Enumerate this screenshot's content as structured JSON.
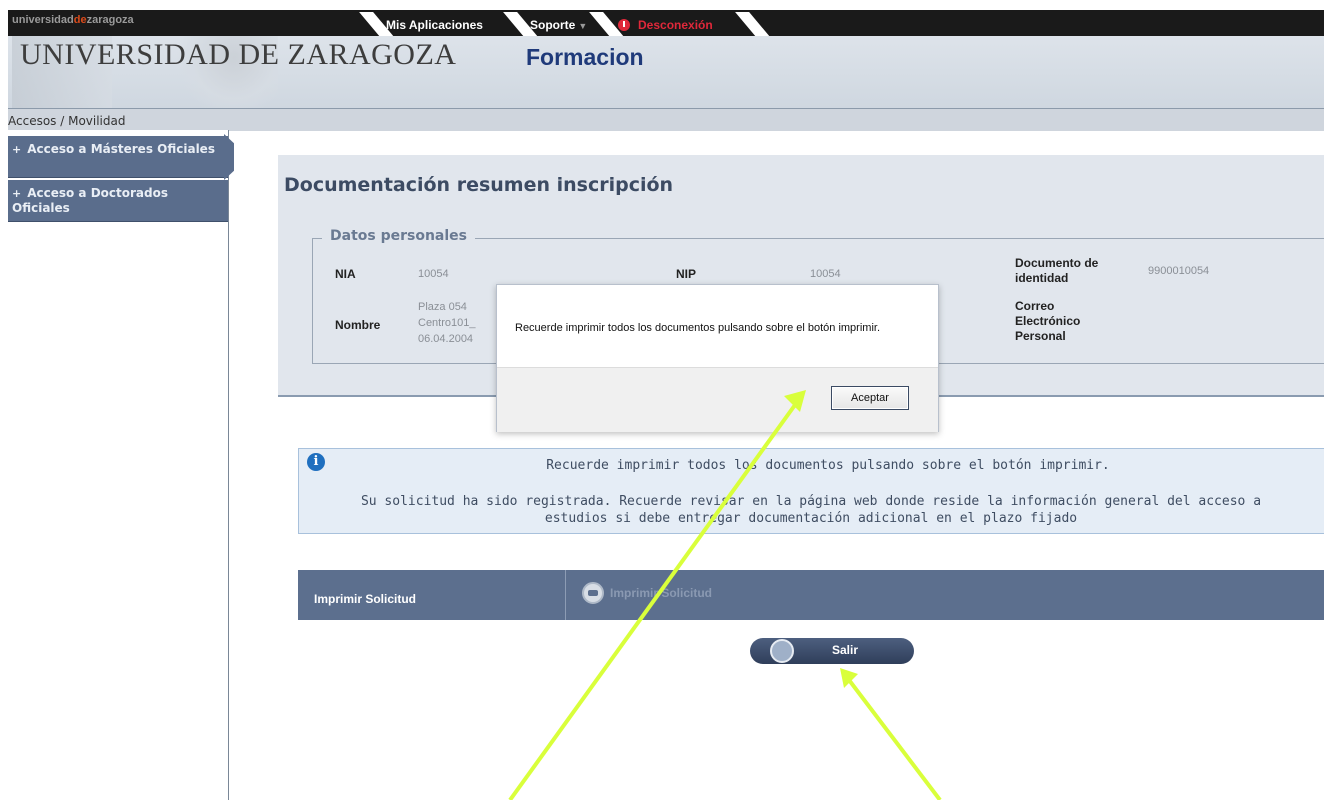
{
  "brand": {
    "part1": "universidad",
    "part2": "de",
    "part3": "zaragoza"
  },
  "topnav": {
    "mis_aplicaciones": "Mis Aplicaciones",
    "soporte": "Soporte",
    "desconexion": "Desconexión"
  },
  "header": {
    "university": "UNIVERSIDAD DE ZARAGOZA",
    "app": "Formacion"
  },
  "breadcrumb": "Accesos / Movilidad",
  "sidebar": {
    "items": [
      {
        "label": "Acceso a Másteres Oficiales"
      },
      {
        "label": "Acceso a Doctorados Oficiales"
      }
    ]
  },
  "main": {
    "title": "Documentación resumen inscripción",
    "datos": {
      "legend": "Datos personales",
      "nia_label": "NIA",
      "nia_value": "10054",
      "nip_label": "NIP",
      "nip_value": "10054",
      "doc_label_1": "Documento de",
      "doc_label_2": "identidad",
      "doc_value": "9900010054",
      "nombre_label": "Nombre",
      "nombre_value_1": "Plaza 054",
      "nombre_value_2": "Centro101_",
      "nombre_value_3": "06.04.2004",
      "correo_label_1": "Correo",
      "correo_label_2": "Electrónico",
      "correo_label_3": "Personal"
    }
  },
  "info": {
    "line1": "Recuerde imprimir todos los documentos pulsando sobre el botón imprimir.",
    "line2": "Su solicitud ha sido registrada. Recuerde revisar en la página web donde reside la información general del acceso a",
    "line3": "estudios si debe entregar documentación adicional en el plazo fijado"
  },
  "print": {
    "label": "Imprimir Solicitud",
    "button": "Imprimir Solicitud"
  },
  "salir": {
    "label": "Salir"
  },
  "modal": {
    "message": "Recuerde imprimir todos los documentos pulsando sobre el botón imprimir.",
    "button": "Aceptar"
  },
  "colors": {
    "accent": "#1f3a7a",
    "sidebar": "#5a6d8c",
    "annotation": "#d9ff3b"
  }
}
